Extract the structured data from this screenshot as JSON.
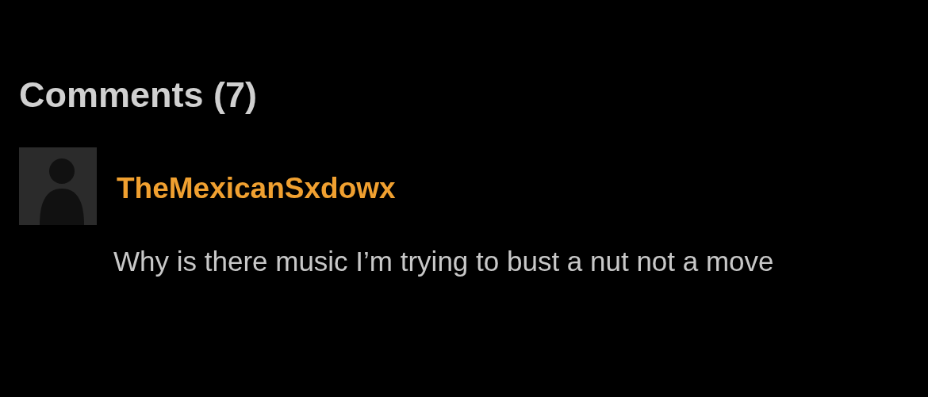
{
  "comments_section": {
    "title": "Comments (7)",
    "comments": [
      {
        "username": "TheMexicanSxdowx",
        "text": "Why is there music I’m trying to bust a nut not a move"
      }
    ]
  }
}
